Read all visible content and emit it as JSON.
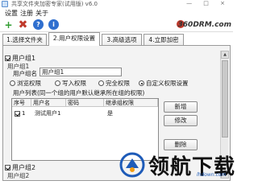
{
  "window": {
    "title": "共享文件夹加密专家(试用版) v6.0",
    "controls": "— □ ×"
  },
  "menu": {
    "items": [
      "设置",
      "注册",
      "关于"
    ]
  },
  "toolbar": {
    "brand": "360DRM.com",
    "icons": [
      "add-icon",
      "remove-icon",
      "help-icon",
      "info-icon"
    ]
  },
  "tabs": [
    {
      "label": "1.选择文件夹",
      "active": false
    },
    {
      "label": "2.用户权限设置",
      "active": true
    },
    {
      "label": "3.高级选项",
      "active": false
    },
    {
      "label": "4.立即加密",
      "active": false
    }
  ],
  "group1": {
    "header": "用户组1",
    "title": "用户组1",
    "name_label": "用户组名",
    "name_value": "用户组1",
    "radios": [
      {
        "label": "浏览权限",
        "checked": false
      },
      {
        "label": "写入权限",
        "checked": false
      },
      {
        "label": "完全权限",
        "checked": false
      },
      {
        "label": "自定义权限设置",
        "checked": true
      }
    ],
    "list_caption": "用户列表(同一个组的用户默认继承所在组的权限)",
    "table": {
      "headers": [
        "序号",
        "用户名",
        "密码",
        "继承组权限"
      ],
      "rows": [
        {
          "index": "1",
          "username": "测试用户1",
          "password": "",
          "inherit": "是"
        }
      ]
    },
    "buttons": {
      "add": "新增",
      "edit": "修改",
      "delete": "删除"
    }
  },
  "group2": {
    "header": "用户组2",
    "title": "用户组2"
  },
  "watermark": {
    "text": "领航下载",
    "sub": "lhdown.com"
  }
}
